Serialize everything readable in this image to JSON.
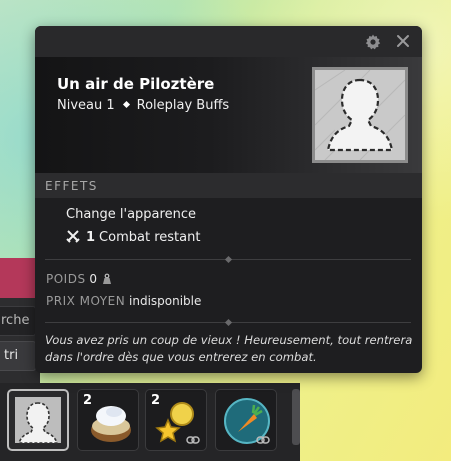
{
  "background": {
    "search_placeholder": "rche",
    "sort_button": "tri",
    "inventory_slots": [
      {
        "icon": "silhouette-icon",
        "qty": "",
        "selected": true
      },
      {
        "icon": "cream-pot-icon",
        "qty": "2",
        "selected": false
      },
      {
        "icon": "star-coin-icon",
        "qty": "2",
        "selected": false
      },
      {
        "icon": "carrot-orb-icon",
        "qty": "",
        "selected": false
      }
    ]
  },
  "tooltip": {
    "title": "Un air de Piloztère",
    "level": "Niveau 1",
    "category": "Roleplay Buffs",
    "section_effects": "EFFETS",
    "effects": {
      "line1": "Change l'apparence",
      "count": "1",
      "line2": "Combat restant"
    },
    "weight_label": "POIDS",
    "weight_value": "0",
    "price_label": "PRIX MOYEN",
    "price_value": "indisponible",
    "description": "Vous avez pris un coup de vieux ! Heureusement, tout rentrera dans l'ordre dès que vous entrerez en combat."
  },
  "colors": {
    "tooltip_bg": "#1e1e20",
    "section_bar": "#2c2c2e",
    "portrait_bg": "#cfcfcf"
  }
}
